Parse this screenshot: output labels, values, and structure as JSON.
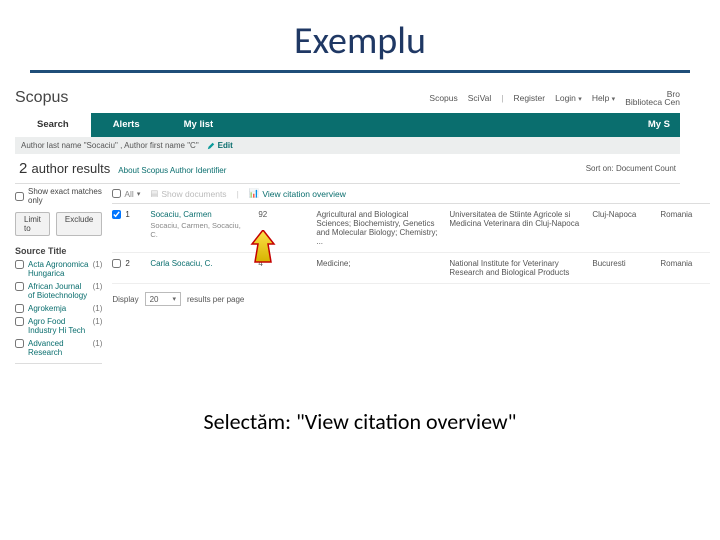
{
  "slide": {
    "title": "Exemplu",
    "caption_prefix": "Selectăm: ",
    "caption_quote": "\"View citation overview\""
  },
  "brand": "Scopus",
  "top_links": {
    "scopus": "Scopus",
    "scival": "SciVal",
    "register": "Register",
    "login": "Login",
    "help": "Help",
    "lib_line1": "Bro",
    "lib_line2": "Biblioteca Cen"
  },
  "nav": {
    "search": "Search",
    "alerts": "Alerts",
    "mylist": "My list",
    "mys": "My S"
  },
  "query": {
    "text": "Author last name \"Socaciu\" , Author first name \"C\"",
    "edit": "Edit"
  },
  "results": {
    "count": "2",
    "label": "author results",
    "about": "About Scopus Author Identifier",
    "sort": "Sort on: Document Count"
  },
  "sidebar": {
    "exact": "Show exact matches only",
    "limit": "Limit to",
    "exclude": "Exclude",
    "source_title": "Source Title",
    "facets": [
      {
        "label": "Acta Agronomica Hungarica",
        "count": "(1)"
      },
      {
        "label": "African Journal of Biotechnology",
        "count": "(1)"
      },
      {
        "label": "Agrokemja",
        "count": "(1)"
      },
      {
        "label": "Agro Food Industry Hi Tech",
        "count": "(1)"
      },
      {
        "label": "Advanced Research",
        "count": "(1)"
      }
    ]
  },
  "toolbar": {
    "all": "All",
    "show_docs": "Show documents",
    "view_cit": "View citation overview"
  },
  "rows": [
    {
      "idx": "1",
      "name": "Socaciu, Carmen",
      "alt": "Socaciu, Carmen,\nSocaciu, C.",
      "docs": "92",
      "subject": "Agricultural and Biological Sciences; Biochemistry, Genetics and Molecular Biology; Chemistry; ...",
      "aff": "Universitatea de Stiinte Agricole si Medicina Veterinara din Cluj-Napoca",
      "city": "Cluj-Napoca",
      "country": "Romania"
    },
    {
      "idx": "2",
      "name": "Carla Socaciu, C.",
      "alt": "",
      "docs": "4",
      "subject": "Medicine;",
      "aff": "National Institute for Veterinary Research and Biological Products",
      "city": "Bucuresti",
      "country": "Romania"
    }
  ],
  "pager": {
    "display": "Display",
    "value": "20",
    "suffix": "results per page"
  }
}
